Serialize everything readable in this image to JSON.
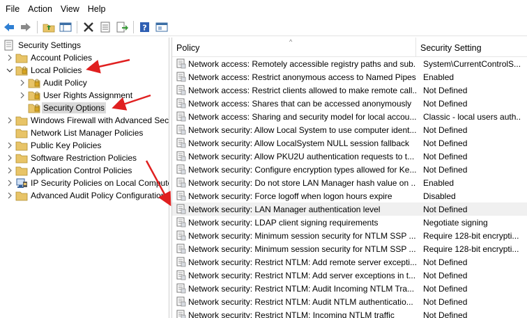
{
  "menu": [
    "File",
    "Action",
    "View",
    "Help"
  ],
  "toolbar": {
    "buttons": [
      "back-icon",
      "forward-icon",
      "up-folder-icon",
      "show-hide-tree-icon",
      "delete-icon",
      "properties-icon",
      "export-list-icon",
      "help-icon",
      "console-icon"
    ]
  },
  "tree": {
    "root": "Security Settings",
    "items": [
      {
        "label": "Account Policies",
        "icon": "folder-icon",
        "toggle": ">"
      },
      {
        "label": "Local Policies",
        "icon": "folder-open-icon",
        "toggle": "v"
      },
      {
        "label": "Audit Policy",
        "icon": "folder-icon",
        "toggle": ">"
      },
      {
        "label": "User Rights Assignment",
        "icon": "folder-icon",
        "toggle": ">"
      },
      {
        "label": "Security Options",
        "icon": "folder-icon",
        "toggle": ""
      },
      {
        "label": "Windows Firewall with Advanced Security",
        "icon": "folder-icon",
        "toggle": ">"
      },
      {
        "label": "Network List Manager Policies",
        "icon": "folder-icon",
        "toggle": ""
      },
      {
        "label": "Public Key Policies",
        "icon": "folder-icon",
        "toggle": ">"
      },
      {
        "label": "Software Restriction Policies",
        "icon": "folder-icon",
        "toggle": ">"
      },
      {
        "label": "Application Control Policies",
        "icon": "folder-icon",
        "toggle": ">"
      },
      {
        "label": "IP Security Policies on Local Computer",
        "icon": "ip-security-icon",
        "toggle": ">"
      },
      {
        "label": "Advanced Audit Policy Configuration",
        "icon": "folder-icon",
        "toggle": ">"
      }
    ]
  },
  "list": {
    "columns": [
      "Policy",
      "Security Setting"
    ],
    "sort_indicator": "^",
    "rows": [
      {
        "policy": "Network access: Remotely accessible registry paths and sub...",
        "setting": "System\\CurrentControlS..."
      },
      {
        "policy": "Network access: Restrict anonymous access to Named Pipes...",
        "setting": "Enabled"
      },
      {
        "policy": "Network access: Restrict clients allowed to make remote call...",
        "setting": "Not Defined"
      },
      {
        "policy": "Network access: Shares that can be accessed anonymously",
        "setting": "Not Defined"
      },
      {
        "policy": "Network access: Sharing and security model for local accou...",
        "setting": "Classic - local users auth..."
      },
      {
        "policy": "Network security: Allow Local System to use computer ident...",
        "setting": "Not Defined"
      },
      {
        "policy": "Network security: Allow LocalSystem NULL session fallback",
        "setting": "Not Defined"
      },
      {
        "policy": "Network security: Allow PKU2U authentication requests to t...",
        "setting": "Not Defined"
      },
      {
        "policy": "Network security: Configure encryption types allowed for Ke...",
        "setting": "Not Defined"
      },
      {
        "policy": "Network security: Do not store LAN Manager hash value on ...",
        "setting": "Enabled"
      },
      {
        "policy": "Network security: Force logoff when logon hours expire",
        "setting": "Disabled"
      },
      {
        "policy": "Network security: LAN Manager authentication level",
        "setting": "Not Defined"
      },
      {
        "policy": "Network security: LDAP client signing requirements",
        "setting": "Negotiate signing"
      },
      {
        "policy": "Network security: Minimum session security for NTLM SSP ...",
        "setting": "Require 128-bit encrypti..."
      },
      {
        "policy": "Network security: Minimum session security for NTLM SSP ...",
        "setting": "Require 128-bit encrypti..."
      },
      {
        "policy": "Network security: Restrict NTLM: Add remote server excepti...",
        "setting": "Not Defined"
      },
      {
        "policy": "Network security: Restrict NTLM: Add server exceptions in t...",
        "setting": "Not Defined"
      },
      {
        "policy": "Network security: Restrict NTLM: Audit Incoming NTLM Tra...",
        "setting": "Not Defined"
      },
      {
        "policy": "Network security: Restrict NTLM: Audit NTLM authenticatio...",
        "setting": "Not Defined"
      },
      {
        "policy": "Network security: Restrict NTLM: Incoming NTLM traffic",
        "setting": "Not Defined"
      }
    ]
  },
  "colors": {
    "selected_row": "#f0f0f0",
    "selected_tree": "#d9d9d9",
    "annotation_arrow": "#e02020",
    "folder": "#e8c468"
  }
}
